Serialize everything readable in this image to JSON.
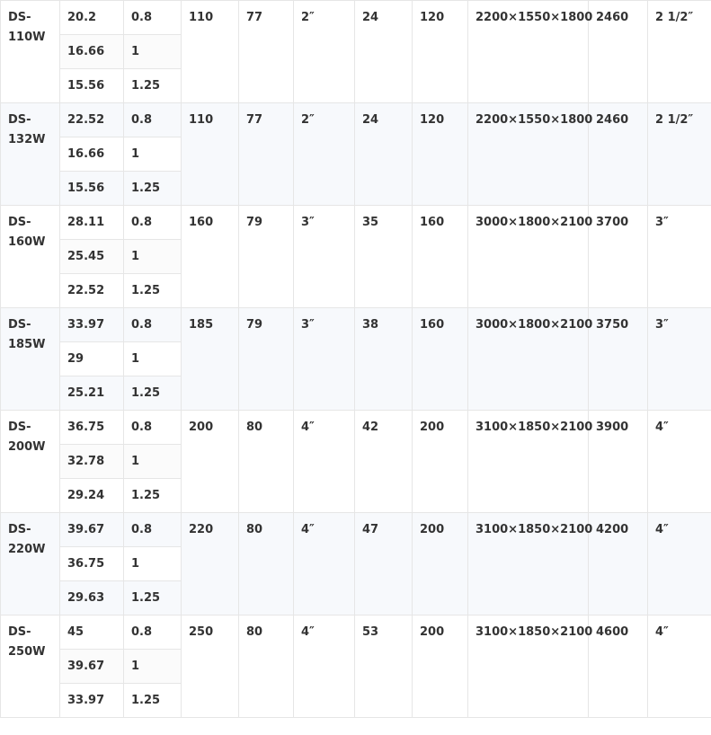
{
  "table": {
    "rows": [
      {
        "model": "DS-110W",
        "flow": [
          "20.2",
          "16.66",
          "15.56"
        ],
        "pressure": [
          "0.8",
          "1",
          "1.25"
        ],
        "c3": "110",
        "c4": "77",
        "c5": "2″",
        "c6": "24",
        "c7": "120",
        "dims": "2200×1550×1800",
        "weight": "2460",
        "outlet": "2 1/2″"
      },
      {
        "model": "DS-132W",
        "flow": [
          "22.52",
          "16.66",
          "15.56"
        ],
        "pressure": [
          "0.8",
          "1",
          "1.25"
        ],
        "c3": "110",
        "c4": "77",
        "c5": "2″",
        "c6": "24",
        "c7": "120",
        "dims": "2200×1550×1800",
        "weight": "2460",
        "outlet": "2 1/2″"
      },
      {
        "model": "DS-160W",
        "flow": [
          "28.11",
          "25.45",
          "22.52"
        ],
        "pressure": [
          "0.8",
          "1",
          "1.25"
        ],
        "c3": "160",
        "c4": "79",
        "c5": "3″",
        "c6": "35",
        "c7": "160",
        "dims": "3000×1800×2100",
        "weight": "3700",
        "outlet": "3″"
      },
      {
        "model": "DS-185W",
        "flow": [
          "33.97",
          "29",
          "25.21"
        ],
        "pressure": [
          "0.8",
          "1",
          "1.25"
        ],
        "c3": "185",
        "c4": "79",
        "c5": "3″",
        "c6": "38",
        "c7": "160",
        "dims": "3000×1800×2100",
        "weight": "3750",
        "outlet": "3″"
      },
      {
        "model": "DS-200W",
        "flow": [
          "36.75",
          "32.78",
          "29.24"
        ],
        "pressure": [
          "0.8",
          "1",
          "1.25"
        ],
        "c3": "200",
        "c4": "80",
        "c5": "4″",
        "c6": "42",
        "c7": "200",
        "dims": "3100×1850×2100",
        "weight": "3900",
        "outlet": "4″"
      },
      {
        "model": "DS-220W",
        "flow": [
          "39.67",
          "36.75",
          "29.63"
        ],
        "pressure": [
          "0.8",
          "1",
          "1.25"
        ],
        "c3": "220",
        "c4": "80",
        "c5": "4″",
        "c6": "47",
        "c7": "200",
        "dims": "3100×1850×2100",
        "weight": "4200",
        "outlet": "4″"
      },
      {
        "model": "DS-250W",
        "flow": [
          "45",
          "39.67",
          "33.97"
        ],
        "pressure": [
          "0.8",
          "1",
          "1.25"
        ],
        "c3": "250",
        "c4": "80",
        "c5": "4″",
        "c6": "53",
        "c7": "200",
        "dims": "3100×1850×2100",
        "weight": "4600",
        "outlet": "4″"
      }
    ]
  }
}
